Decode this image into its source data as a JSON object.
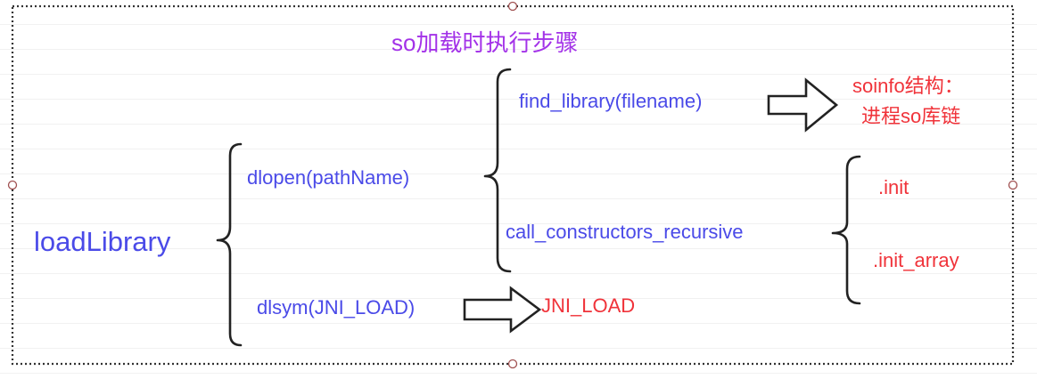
{
  "diagram": {
    "title": "so加载时执行步骤",
    "root": "loadLibrary",
    "dlopen": "dlopen(pathName)",
    "dlsym": "dlsym(JNI_LOAD)",
    "find_library": "find_library(filename)",
    "call_constructors": "call_constructors_recursive",
    "soinfo_line1": "soinfo结构：",
    "soinfo_line2": "进程so库链",
    "init": ".init",
    "init_array": ".init_array",
    "jni_load": "JNI_LOAD"
  },
  "colors": {
    "node_blue": "#4a4ae8",
    "title_purple": "#a332e8",
    "result_red": "#f0333a",
    "brace_black": "#222222",
    "frame_dots": "#333333",
    "handle": "#a05050"
  }
}
